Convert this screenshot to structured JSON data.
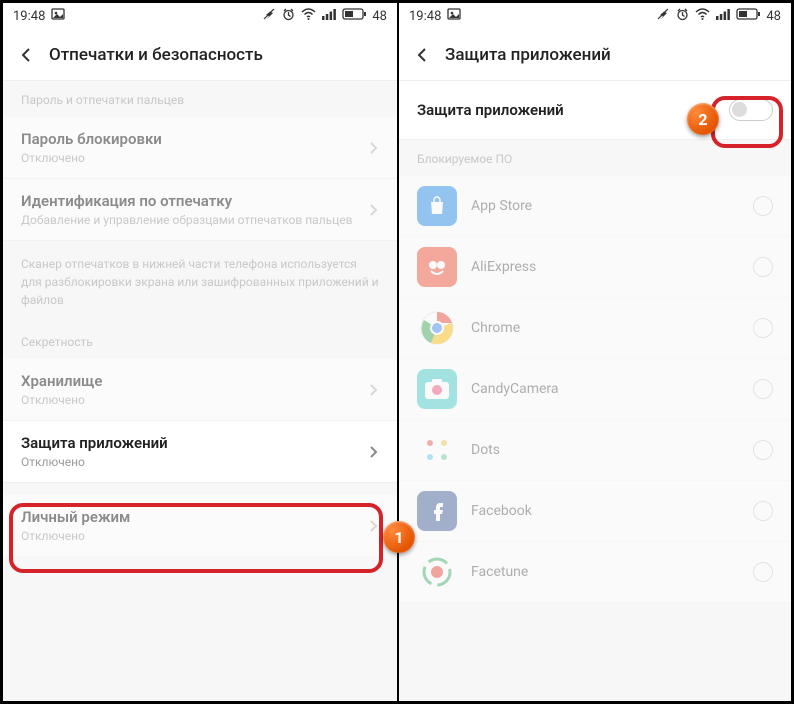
{
  "status": {
    "time": "19:48",
    "battery": "48"
  },
  "left": {
    "title": "Отпечатки и безопасность",
    "section1": "Пароль и отпечатки пальцев",
    "items": [
      {
        "title": "Пароль блокировки",
        "subtitle": "Отключено"
      },
      {
        "title": "Идентификация по отпечатку",
        "subtitle": "Добавление и управление образцами отпечатков пальцев"
      }
    ],
    "info": "Сканер отпечатков в нижней части телефона используется для разблокировки экрана или зашифрованных приложений и файлов",
    "section2": "Секретность",
    "items2": [
      {
        "title": "Хранилище",
        "subtitle": "Отключено"
      },
      {
        "title": "Защита приложений",
        "subtitle": "Отключено"
      },
      {
        "title": "Личный режим",
        "subtitle": "Отключено"
      }
    ]
  },
  "right": {
    "title": "Защита приложений",
    "toggle_label": "Защита приложений",
    "section": "Блокируемое ПО",
    "apps": [
      {
        "name": "App Store",
        "bg": "#1b87e6",
        "glyph": "bag"
      },
      {
        "name": "AliExpress",
        "bg": "#f04a2d",
        "glyph": "ali"
      },
      {
        "name": "Chrome",
        "bg": "#fff",
        "glyph": "chrome"
      },
      {
        "name": "CandyCamera",
        "bg": "#3cc9c8",
        "glyph": "cam"
      },
      {
        "name": "Dots",
        "bg": "#fff",
        "glyph": "dots"
      },
      {
        "name": "Facebook",
        "bg": "#3b5998",
        "glyph": "fb"
      },
      {
        "name": "Facetune",
        "bg": "#fff",
        "glyph": "ft"
      }
    ]
  },
  "callouts": {
    "n1": "1",
    "n2": "2"
  }
}
